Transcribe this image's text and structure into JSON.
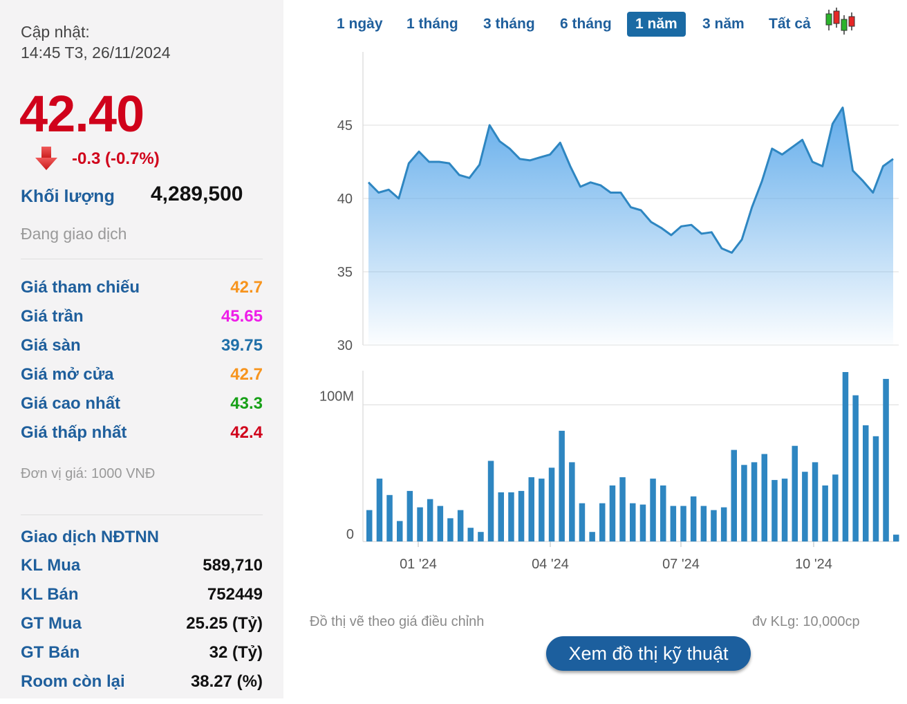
{
  "summary": {
    "update_label": "Cập nhật:",
    "update_time": "14:45 T3, 26/11/2024",
    "price": "42.40",
    "change": "-0.3 (-0.7%)",
    "volume_label": "Khối lượng",
    "volume_value": "4,289,500",
    "trading_status": "Đang giao dịch",
    "unit_note": "Đơn vị giá: 1000 VNĐ",
    "colors": {
      "down": "#d0021b",
      "label": "#1f5f9c"
    }
  },
  "prices": [
    {
      "label": "Giá tham chiếu",
      "value": "42.7",
      "color": "#f7941d"
    },
    {
      "label": "Giá trần",
      "value": "45.65",
      "color": "#ee1ee8"
    },
    {
      "label": "Giá sàn",
      "value": "39.75",
      "color": "#1f6fa8"
    },
    {
      "label": "Giá mở cửa",
      "value": "42.7",
      "color": "#f7941d"
    },
    {
      "label": "Giá cao nhất",
      "value": "43.3",
      "color": "#17a017"
    },
    {
      "label": "Giá thấp nhất",
      "value": "42.4",
      "color": "#d0021b"
    }
  ],
  "foreign": {
    "title": "Giao dịch NĐTNN",
    "rows": [
      {
        "label": "KL Mua",
        "value": "589,710"
      },
      {
        "label": "KL Bán",
        "value": "752449"
      },
      {
        "label": "GT Mua",
        "value": "25.25 (Tỷ)"
      },
      {
        "label": "GT Bán",
        "value": "32 (Tỷ)"
      },
      {
        "label": "Room còn lại",
        "value": "38.27 (%)"
      }
    ]
  },
  "tabs": [
    {
      "label": "1 ngày",
      "active": false
    },
    {
      "label": "1 tháng",
      "active": false
    },
    {
      "label": "3 tháng",
      "active": false
    },
    {
      "label": "6 tháng",
      "active": false
    },
    {
      "label": "1 năm",
      "active": true
    },
    {
      "label": "3 năm",
      "active": false
    },
    {
      "label": "Tất cả",
      "active": false
    }
  ],
  "icons": {
    "chart_type": "candlestick-icon",
    "price_down": "arrow-down-icon"
  },
  "chart_data": [
    {
      "type": "area",
      "y_ticks": [
        "30",
        "35",
        "40",
        "45"
      ],
      "ylim": [
        30,
        50
      ],
      "grid": true,
      "color": "#2e86c1",
      "series": [
        {
          "values": [
            41.1,
            40.4,
            40.6,
            40.0,
            42.4,
            43.2,
            42.5,
            42.5,
            42.4,
            41.6,
            41.4,
            42.3,
            45.0,
            43.9,
            43.4,
            42.7,
            42.6,
            42.8,
            43.0,
            43.8,
            42.2,
            40.8,
            41.1,
            40.9,
            40.4,
            40.4,
            39.4,
            39.2,
            38.4,
            38.0,
            37.5,
            38.1,
            38.2,
            37.6,
            37.7,
            36.6,
            36.3,
            37.2,
            39.4,
            41.2,
            43.4,
            43.0,
            43.5,
            44.0,
            42.5,
            42.2,
            45.1,
            46.2,
            41.9,
            41.2,
            40.4,
            42.2,
            42.7
          ]
        }
      ]
    },
    {
      "type": "bar",
      "y_ticks": [
        "0",
        "100M"
      ],
      "ylim": [
        0,
        125
      ],
      "x_ticks": [
        "01 '24",
        "04 '24",
        "07 '24",
        "10 '24"
      ],
      "grid": true,
      "color": "#2e86c1",
      "series": [
        {
          "values": [
            23,
            46,
            34,
            15,
            37,
            25,
            31,
            26,
            17,
            23,
            10,
            7,
            59,
            36,
            36,
            37,
            47,
            46,
            54,
            81,
            58,
            28,
            7,
            28,
            41,
            47,
            28,
            27,
            46,
            41,
            26,
            26,
            33,
            26,
            23,
            25,
            67,
            56,
            58,
            64,
            45,
            46,
            70,
            51,
            58,
            41,
            49,
            124,
            107,
            85,
            77,
            119,
            5
          ]
        }
      ]
    }
  ],
  "footer": {
    "note_left": "Đồ thị vẽ theo giá điều chỉnh",
    "note_right": "đv KLg: 10,000cp",
    "tech_button": "Xem đồ thị kỹ thuật"
  }
}
